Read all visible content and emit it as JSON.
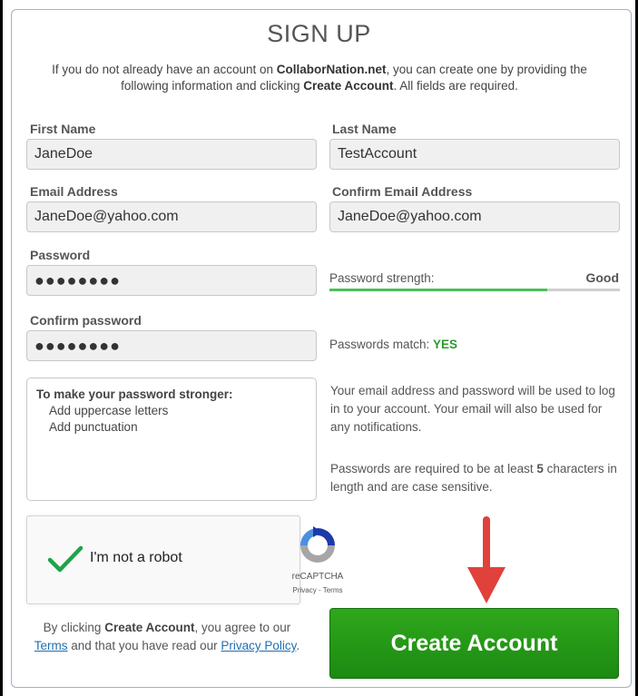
{
  "form": {
    "title": "SIGN UP",
    "intro_part1": "If you do not already have an account on ",
    "intro_site": "CollaborNation.net",
    "intro_part2": ", you can create one by providing the following information and clicking ",
    "intro_button": "Create Account",
    "intro_part3": ". All fields are required."
  },
  "fields": {
    "first_name": {
      "label": "First Name",
      "value": "JaneDoe"
    },
    "last_name": {
      "label": "Last Name",
      "value": "TestAccount"
    },
    "email": {
      "label": "Email Address",
      "value": "JaneDoe@yahoo.com"
    },
    "confirm_email": {
      "label": "Confirm Email Address",
      "value": "JaneDoe@yahoo.com"
    },
    "password": {
      "label": "Password",
      "value": "●●●●●●●●"
    },
    "confirm_password": {
      "label": "Confirm password",
      "value": "●●●●●●●●"
    }
  },
  "strength": {
    "label": "Password strength:",
    "value": "Good",
    "fraction": 0.75,
    "fill_color": "#4ebf5a"
  },
  "match": {
    "label": "Passwords match: ",
    "value": "YES"
  },
  "tips": {
    "title": "To make your password stronger:",
    "items": [
      "Add uppercase letters",
      "Add punctuation"
    ]
  },
  "info": {
    "paragraph1": "Your email address and password will be used to log in to your account. Your email will also be used for any notifications.",
    "paragraph2_part1": "Passwords are required to be at least ",
    "paragraph2_min": "5",
    "paragraph2_part2": " characters in length and are case sensitive."
  },
  "recaptcha": {
    "label": "I'm not a robot",
    "brand": "reCAPTCHA",
    "links": "Privacy - Terms"
  },
  "legal": {
    "part1": "By clicking ",
    "button_ref": "Create Account",
    "part2": ", you agree to our ",
    "terms_link": "Terms",
    "part3": " and that you have read our ",
    "privacy_link": "Privacy Policy",
    "part4": "."
  },
  "actions": {
    "create_label": "Create Account"
  },
  "icons": {
    "check": "checkmark-icon",
    "recaptcha": "recaptcha-logo-icon",
    "arrow": "down-arrow-icon"
  },
  "colors": {
    "button_green": "#1c8a12",
    "yes_green": "#2e9a2e",
    "arrow_red": "#e0413a",
    "link_blue": "#1f6fb0"
  }
}
